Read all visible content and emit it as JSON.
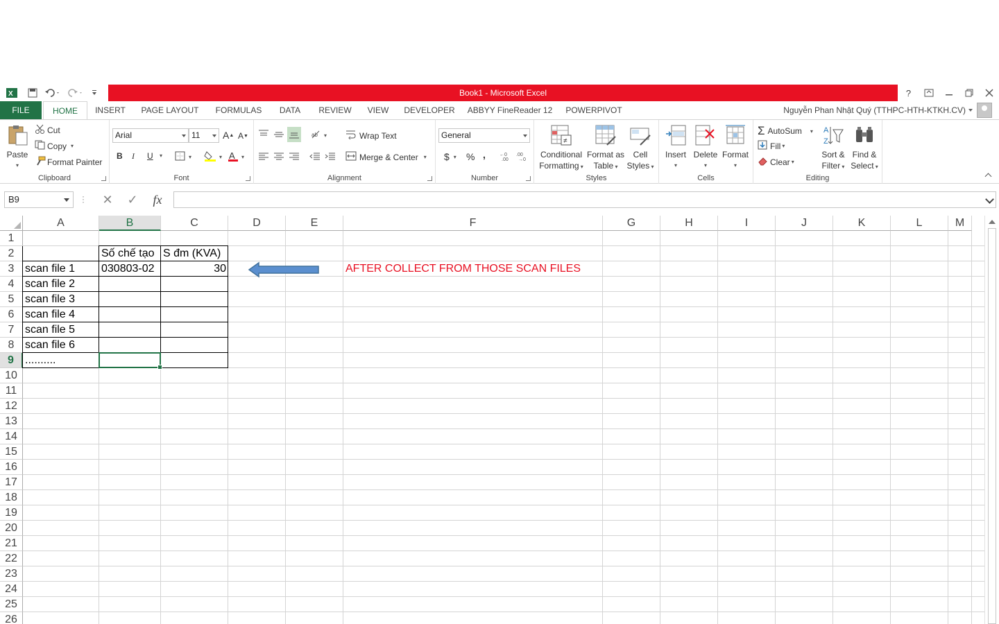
{
  "window": {
    "title": "Book1 -  Microsoft Excel",
    "help": "?",
    "controls": [
      "restore-ribbon",
      "minimize",
      "maximize",
      "close"
    ]
  },
  "tabs": [
    "FILE",
    "HOME",
    "INSERT",
    "PAGE LAYOUT",
    "FORMULAS",
    "DATA",
    "REVIEW",
    "VIEW",
    "DEVELOPER",
    "ABBYY FineReader 12",
    "POWERPIVOT"
  ],
  "user": "Nguyễn Phan Nhật Quý (TTHPC-HTH-KTKH.CV)",
  "ribbon": {
    "clipboard": {
      "label": "Clipboard",
      "paste": "Paste",
      "cut": "Cut",
      "copy": "Copy",
      "format_painter": "Format Painter"
    },
    "font": {
      "label": "Font",
      "name": "Arial",
      "size": "11",
      "bold": "B",
      "italic": "I",
      "underline": "U"
    },
    "alignment": {
      "label": "Alignment",
      "wrap_text": "Wrap Text",
      "merge_center": "Merge & Center"
    },
    "number": {
      "label": "Number",
      "format": "General",
      "currency": "$",
      "percent": "%",
      "comma": ","
    },
    "styles": {
      "label": "Styles",
      "conditional_1": "Conditional",
      "conditional_2": "Formatting",
      "format_table_1": "Format as",
      "format_table_2": "Table",
      "cell_styles_1": "Cell",
      "cell_styles_2": "Styles"
    },
    "cells": {
      "label": "Cells",
      "insert": "Insert",
      "delete": "Delete",
      "format": "Format"
    },
    "editing": {
      "label": "Editing",
      "autosum": "AutoSum",
      "fill": "Fill",
      "clear": "Clear",
      "sort_1": "Sort &",
      "sort_2": "Filter",
      "find_1": "Find &",
      "find_2": "Select"
    }
  },
  "formula_bar": {
    "name_box": "B9",
    "fx": "fx",
    "value": ""
  },
  "sheet": {
    "columns": [
      "A",
      "B",
      "C",
      "D",
      "E",
      "F",
      "G",
      "H",
      "I",
      "J",
      "K",
      "L",
      "M"
    ],
    "selected_column": "B",
    "selected_row": 9,
    "rows": [
      "1",
      "2",
      "3",
      "4",
      "5",
      "6",
      "7",
      "8",
      "9",
      "10",
      "11",
      "12",
      "13",
      "14",
      "15",
      "16",
      "17",
      "18",
      "19",
      "20",
      "21",
      "22",
      "23",
      "24",
      "25",
      "26"
    ],
    "cells": {
      "B2": "Số chế tạo",
      "C2": "S đm (KVA)",
      "A3": "scan file 1",
      "B3": "030803-02",
      "C3": "30",
      "A4": "scan file 2",
      "A5": "scan file 3",
      "A6": "scan file 4",
      "A7": "scan file 5",
      "A8": "scan file 6",
      "A9": ".........."
    },
    "annotation": "AFTER COLLECT FROM THOSE SCAN FILES",
    "annotation_color": "#e81123",
    "accent": "#217346"
  }
}
